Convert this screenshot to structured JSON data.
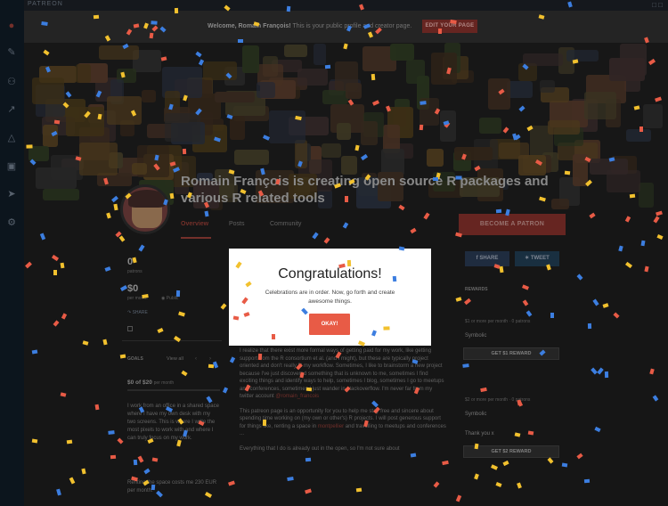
{
  "topbar": {
    "brand": "PATREON"
  },
  "welcome": {
    "name": "Welcome, Romain François!",
    "message": "This is your public profile and creator page.",
    "setup_button": "EDIT YOUR PAGE"
  },
  "cover": {
    "title": "Romain François is creating open source R packages and various R related tools"
  },
  "tabs": {
    "overview": "Overview",
    "posts": "Posts",
    "community": "Community"
  },
  "become_patron": "BECOME A PATRON",
  "stats": {
    "patrons_count": "0",
    "patrons_label": "patrons",
    "per_month": "$0",
    "per_month_label": "per month",
    "visibility": "Public",
    "share_label": "SHARE"
  },
  "goals": {
    "label": "GOALS",
    "view_all": "View all",
    "progress": "$0 of $20",
    "progress_label": "per month"
  },
  "goal_text": "I work from an office in a shared space where I have my own desk with my two screens. This is where I write the most pixels to work with and where I can truly focus on my work.",
  "goal_text2": "Renting the space costs me 230 EUR per month.",
  "social": {
    "facebook": "SHARE",
    "twitter": "TWEET"
  },
  "rewards": {
    "label": "REWARDS",
    "tier1_price": "$1 or more per month",
    "tier1_patrons": "0 patrons",
    "tier1_name": "Symbolic",
    "tier1_button": "GET $1 REWARD",
    "tier2_price": "$2 or more per month",
    "tier2_patrons": "0 patrons",
    "tier2_name": "Symbolic",
    "tier2_desc": "Thank you x",
    "tier2_button": "GET $2 REWARD"
  },
  "body": {
    "p1": "I realize that there exist more formal ways of getting paid for my work, like getting support from the R consortium et al. (and I might), but these are typically project oriented and don't really fit my workflow. Sometimes, I like to brainstorm a new project because I've just discovered something that is unknown to me, sometimes I find exciting things and identify ways to help, sometimes I blog, sometimes I go to meetups and conferences, sometimes I just wander in stackoverflow. I'm never far from my twitter account",
    "p1_link": "@romain_francois",
    "p2": "This patreon page is an opportunity for you to help me stay free and sincere about spending time working on (my own or other's) R projects. I will post generous support for things like, renting a space in",
    "p2_link": "montpellier",
    "p2_end": "and travelling to meetups and conferences ...",
    "p3": "Everything that I do is already out in the open, so I'm not sure about"
  },
  "modal": {
    "title": "Congratulations!",
    "body": "Celebrations are in order. Now, go forth and create awesome things.",
    "okay": "OKAY!"
  },
  "colors": {
    "brand": "#e85b46",
    "confetti": [
      "#f2c12e",
      "#3c7ee0",
      "#e85b46"
    ]
  }
}
